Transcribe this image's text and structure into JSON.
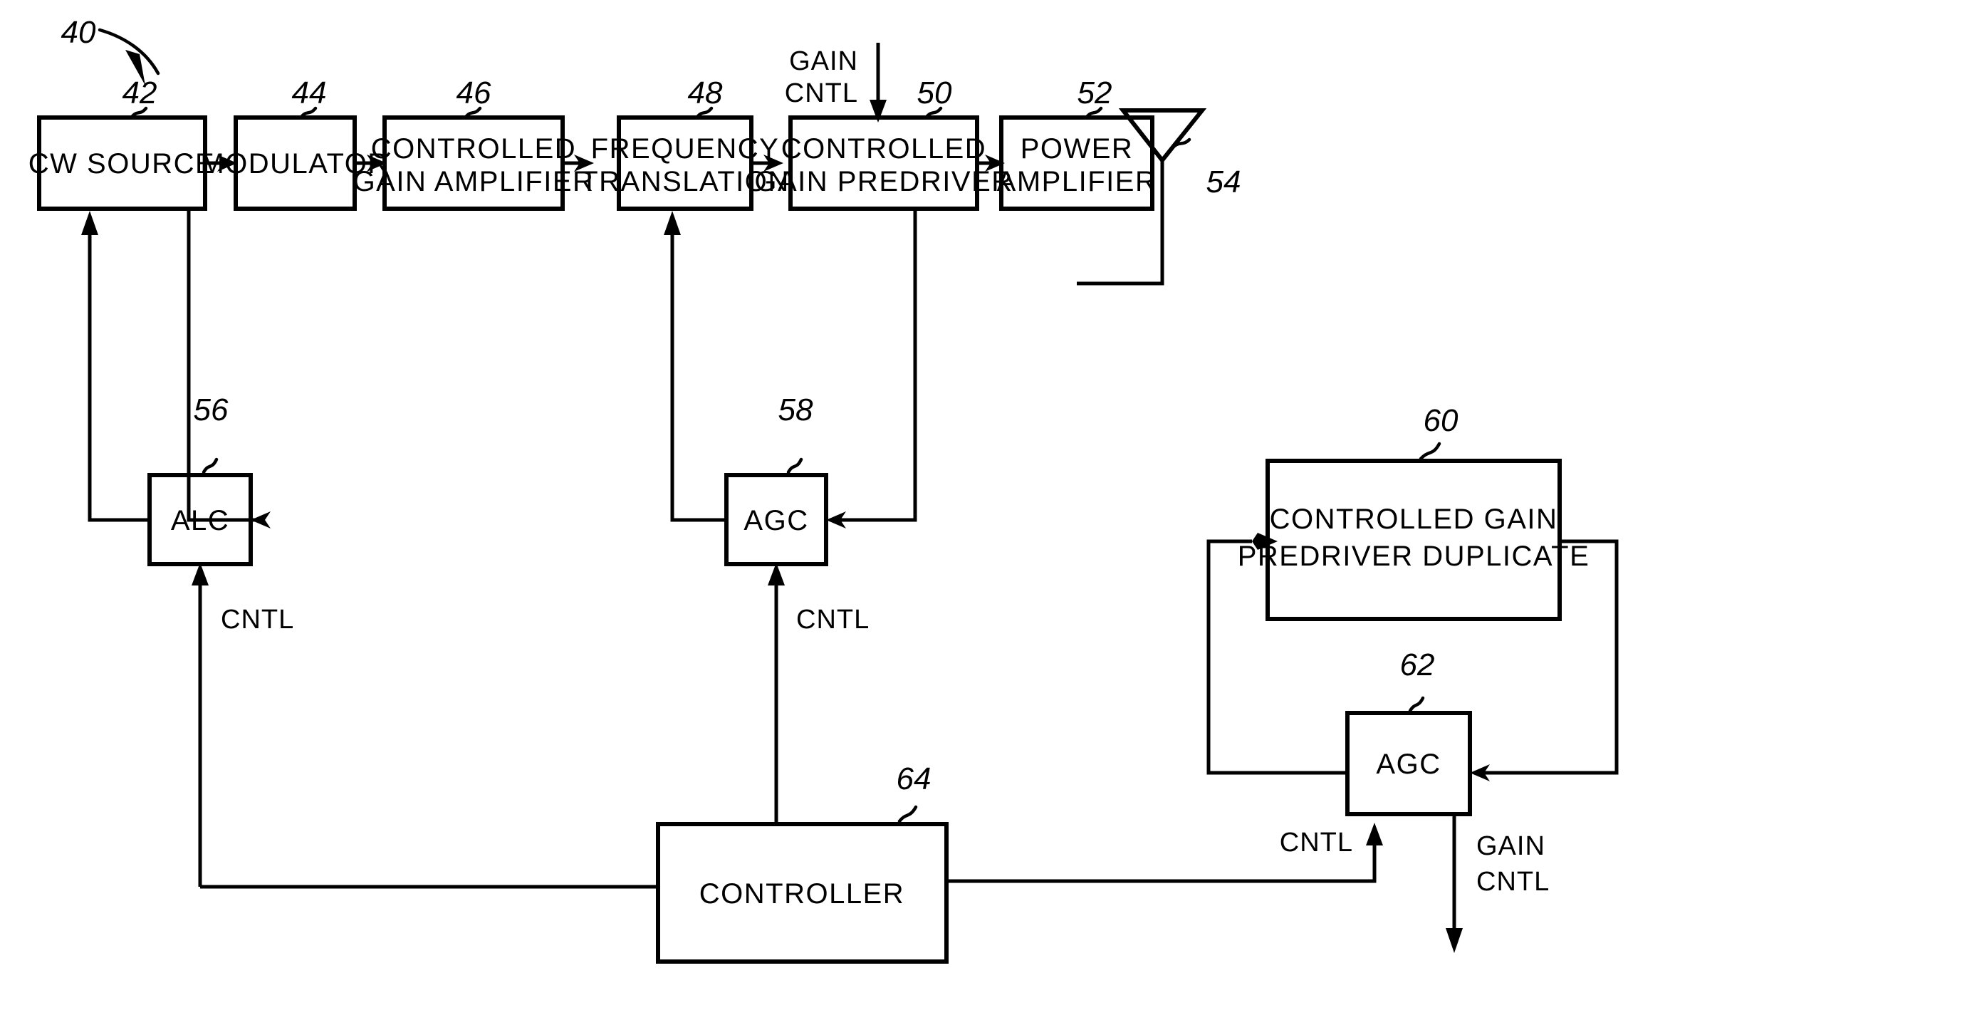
{
  "figure": {
    "figure_ref": "40",
    "blocks": [
      {
        "id": "cw-source",
        "ref": "42",
        "lines": [
          "CW SOURCE"
        ]
      },
      {
        "id": "modulator",
        "ref": "44",
        "lines": [
          "MODULATOR"
        ]
      },
      {
        "id": "controlled-gain-amplifier",
        "ref": "46",
        "lines": [
          "CONTROLLED",
          "GAIN AMPLIFIER"
        ]
      },
      {
        "id": "frequency-translation",
        "ref": "48",
        "lines": [
          "FREQUENCY",
          "TRANSLATION"
        ]
      },
      {
        "id": "controlled-gain-predriver",
        "ref": "50",
        "lines": [
          "CONTROLLED",
          "GAIN PREDRIVER"
        ]
      },
      {
        "id": "power-amplifier",
        "ref": "52",
        "lines": [
          "POWER",
          "AMPLIFIER"
        ]
      },
      {
        "id": "antenna",
        "ref": "54",
        "lines": []
      },
      {
        "id": "alc",
        "ref": "56",
        "lines": [
          "ALC"
        ]
      },
      {
        "id": "agc-main",
        "ref": "58",
        "lines": [
          "AGC"
        ]
      },
      {
        "id": "controlled-gain-predriver-duplicate",
        "ref": "60",
        "lines": [
          "CONTROLLED GAIN",
          "PREDRIVER DUPLICATE"
        ]
      },
      {
        "id": "agc-duplicate",
        "ref": "62",
        "lines": [
          "AGC"
        ]
      },
      {
        "id": "controller",
        "ref": "64",
        "lines": [
          "CONTROLLER"
        ]
      }
    ],
    "signal_labels": {
      "gain_cntl_in_line1": "GAIN",
      "gain_cntl_in_line2": "CNTL",
      "alc_cntl": "CNTL",
      "agc_main_cntl": "CNTL",
      "agc_dup_cntl": "CNTL",
      "gain_cntl_out_line1": "GAIN",
      "gain_cntl_out_line2": "CNTL"
    },
    "colors": {
      "ink": "#000000",
      "paper": "#ffffff"
    }
  }
}
